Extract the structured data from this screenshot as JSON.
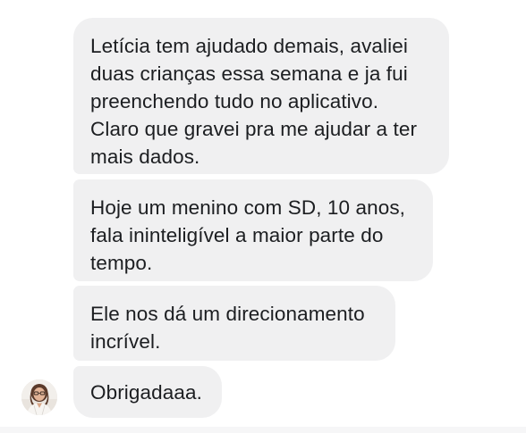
{
  "messages": [
    {
      "text": "Letícia tem ajudado demais, avaliei\nduas crianças essa semana e ja fui\npreenchendo tudo no aplicativo.\nClaro que gravei pra me ajudar a ter\nmais dados."
    },
    {
      "text": "Hoje um menino com SD, 10 anos,\nfala ininteligível a maior parte do\ntempo."
    },
    {
      "text": "Ele nos dá um direcionamento\nincrível."
    },
    {
      "text": "Obrigadaaa."
    }
  ],
  "sender": {
    "avatar_icon": "profile-photo-avatar"
  },
  "colors": {
    "bubble_bg": "#f0f0f1",
    "text": "#1c1e21"
  }
}
